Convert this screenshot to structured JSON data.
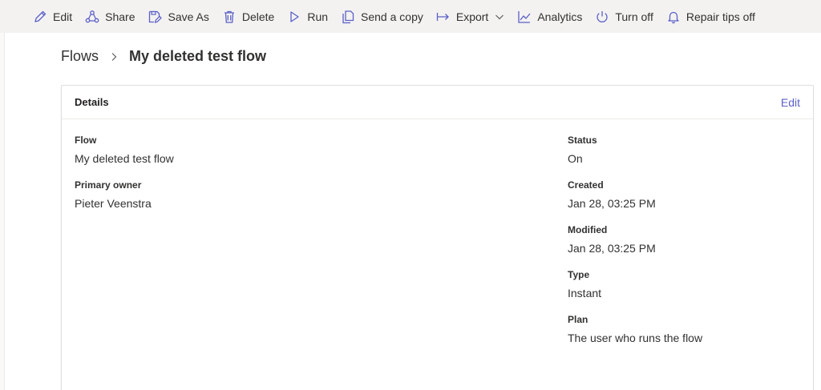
{
  "toolbar": {
    "items": [
      {
        "label": "Edit",
        "icon": "pencil-icon"
      },
      {
        "label": "Share",
        "icon": "share-icon"
      },
      {
        "label": "Save As",
        "icon": "save-as-icon"
      },
      {
        "label": "Delete",
        "icon": "trash-icon"
      },
      {
        "label": "Run",
        "icon": "play-icon"
      },
      {
        "label": "Send a copy",
        "icon": "copy-icon"
      },
      {
        "label": "Export",
        "icon": "export-icon"
      },
      {
        "label": "Analytics",
        "icon": "analytics-icon"
      },
      {
        "label": "Turn off",
        "icon": "power-icon"
      },
      {
        "label": "Repair tips off",
        "icon": "bell-icon"
      }
    ]
  },
  "breadcrumb": {
    "root": "Flows",
    "current": "My deleted test flow"
  },
  "details": {
    "title": "Details",
    "edit_label": "Edit",
    "flow_label": "Flow",
    "flow_value": "My deleted test flow",
    "owner_label": "Primary owner",
    "owner_value": "Pieter Veenstra",
    "status_label": "Status",
    "status_value": "On",
    "created_label": "Created",
    "created_value": "Jan 28, 03:25 PM",
    "modified_label": "Modified",
    "modified_value": "Jan 28, 03:25 PM",
    "type_label": "Type",
    "type_value": "Instant",
    "plan_label": "Plan",
    "plan_value": "The user who runs the flow"
  },
  "colors": {
    "icon": "#5b5fc7",
    "link": "#5b5fc7",
    "toolbar_bg": "#f3f2f1"
  }
}
